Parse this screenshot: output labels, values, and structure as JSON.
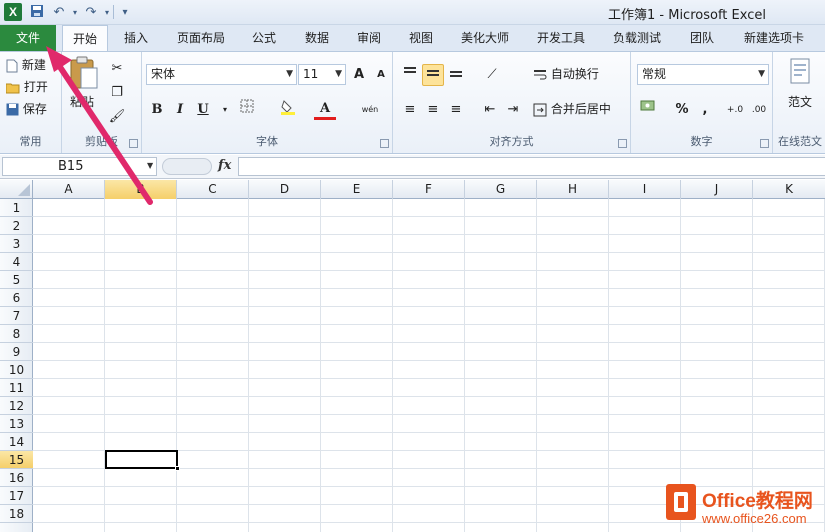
{
  "window": {
    "title": "工作簿1 - Microsoft Excel",
    "app_icon_text": "X"
  },
  "quick_access": {
    "save": "save-icon",
    "undo": "undo-icon",
    "redo": "redo-icon",
    "customize": "dropdown-icon"
  },
  "tabs": [
    {
      "label": "文件"
    },
    {
      "label": "开始"
    },
    {
      "label": "插入"
    },
    {
      "label": "页面布局"
    },
    {
      "label": "公式"
    },
    {
      "label": "数据"
    },
    {
      "label": "审阅"
    },
    {
      "label": "视图"
    },
    {
      "label": "美化大师"
    },
    {
      "label": "开发工具"
    },
    {
      "label": "负载测试"
    },
    {
      "label": "团队"
    },
    {
      "label": "新建选项卡"
    }
  ],
  "ribbon": {
    "common": {
      "new": "新建",
      "open": "打开",
      "save": "保存",
      "label": "常用"
    },
    "clipboard": {
      "paste": "粘贴",
      "label": "剪贴板"
    },
    "font": {
      "name": "宋体",
      "size": "11",
      "grow": "A",
      "shrink": "A",
      "bold": "B",
      "italic": "I",
      "underline": "U",
      "color_glyph": "A",
      "phonetic": "wén",
      "label": "字体"
    },
    "alignment": {
      "wrap": "自动换行",
      "merge": "合并后居中",
      "label": "对齐方式"
    },
    "number": {
      "format": "常规",
      "percent": "%",
      "comma": ",",
      "inc_decimal": "+.0",
      "dec_decimal": ".00",
      "label": "数字"
    },
    "template": {
      "button": "范文",
      "label": "在线范文"
    }
  },
  "formula_bar": {
    "name_box": "B15",
    "fx": "fx",
    "value": ""
  },
  "grid": {
    "columns": [
      "A",
      "B",
      "C",
      "D",
      "E",
      "F",
      "G",
      "H",
      "I",
      "J",
      "K"
    ],
    "rows": [
      "1",
      "2",
      "3",
      "4",
      "5",
      "6",
      "7",
      "8",
      "9",
      "10",
      "11",
      "12",
      "13",
      "14",
      "15",
      "16",
      "17",
      "18"
    ],
    "selected_column": "B",
    "selected_row": "15",
    "active_cell": "B15"
  },
  "watermark": {
    "name": "Office教程网",
    "url": "www.office26.com"
  },
  "colors": {
    "file_tab": "#2b8a3e",
    "selection_header": "#f5cf6a",
    "annotation_arrow": "#e0296b",
    "watermark": "#e8541e"
  }
}
